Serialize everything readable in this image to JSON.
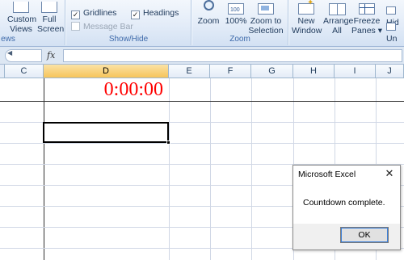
{
  "ribbon": {
    "workbook_views_caption": "ews",
    "custom_views_label": "Custom Views",
    "full_screen_label": "Full Screen",
    "show_hide_caption": "Show/Hide",
    "gridlines_label": "Gridlines",
    "gridlines_checked": true,
    "headings_label": "Headings",
    "headings_checked": true,
    "message_bar_label": "Message Bar",
    "message_bar_checked": false,
    "zoom_caption": "Zoom",
    "zoom_label": "Zoom",
    "hundred_label": "100%",
    "zoom_to_selection_label": "Zoom to Selection",
    "new_window_label": "New Window",
    "arrange_all_label": "Arrange All",
    "freeze_panes_label": "Freeze Panes ▾",
    "hide_label": "Hid",
    "unhide_label": "Un"
  },
  "formula_bar": {
    "fx_label": "fx",
    "formula_value": ""
  },
  "grid": {
    "columns": [
      "C",
      "D",
      "E",
      "F",
      "G",
      "H",
      "I",
      "J"
    ],
    "active_column": "D",
    "timer_value": "0:00:00",
    "timer_color": "#ff0000"
  },
  "dialog": {
    "title": "Microsoft Excel",
    "close_glyph": "✕",
    "message": "Countdown complete.",
    "ok_label": "OK"
  }
}
